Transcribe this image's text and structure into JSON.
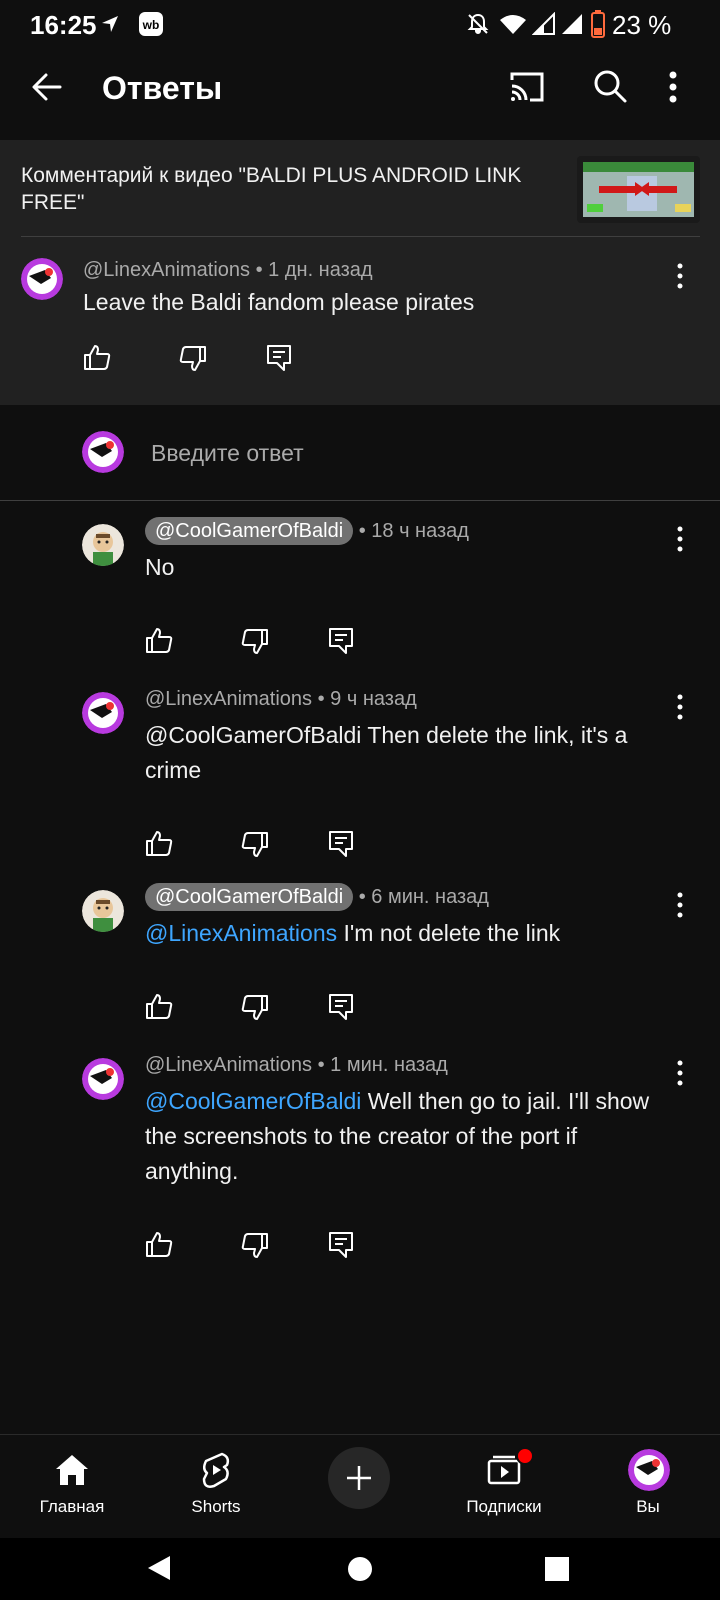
{
  "status_bar": {
    "time": "16:25",
    "battery": "23 %"
  },
  "app_bar": {
    "title": "Ответы",
    "icons": [
      "back-arrow-icon",
      "cast-icon",
      "search-icon",
      "more-vert-icon"
    ]
  },
  "video": {
    "title": "Комментарий к видео \"BALDI PLUS ANDROID LINK FREE\""
  },
  "parent_comment": {
    "author": "@LinexAnimations",
    "time": " • 1 дн. назад",
    "text": "Leave the Baldi fandom please pirates"
  },
  "reply_input": {
    "placeholder": "Введите ответ"
  },
  "replies": [
    {
      "author": "@CoolGamerOfBaldi",
      "author_is_chip": true,
      "time": " • 18 ч назад",
      "mention": "",
      "text": "No"
    },
    {
      "author": "@LinexAnimations",
      "author_is_chip": false,
      "time": " • 9 ч назад",
      "mention": "",
      "text": "@CoolGamerOfBaldi  Then delete the link, it's a crime"
    },
    {
      "author": "@CoolGamerOfBaldi",
      "author_is_chip": true,
      "time": " • 6 мин. назад",
      "mention": " @LinexAnimations",
      "text": " I'm not delete the link"
    },
    {
      "author": "@LinexAnimations",
      "author_is_chip": false,
      "time": " • 1 мин. назад",
      "mention": " @CoolGamerOfBaldi",
      "text": "  Well then go to jail. I'll show the screenshots to the creator of the port if anything."
    }
  ],
  "bottom_nav": {
    "items": [
      {
        "label": "Главная",
        "icon": "home-icon"
      },
      {
        "label": "Shorts",
        "icon": "shorts-icon"
      },
      {
        "label": "",
        "icon": "create-plus-icon"
      },
      {
        "label": "Подписки",
        "icon": "subscriptions-icon"
      },
      {
        "label": "Вы",
        "icon": "profile-avatar-icon"
      }
    ]
  },
  "colors": {
    "background": "#0f0f0f",
    "surface": "#212121",
    "mention": "#3ea6ff",
    "secondary_text": "#aaaaaa",
    "notification_dot": "#ff0000"
  }
}
